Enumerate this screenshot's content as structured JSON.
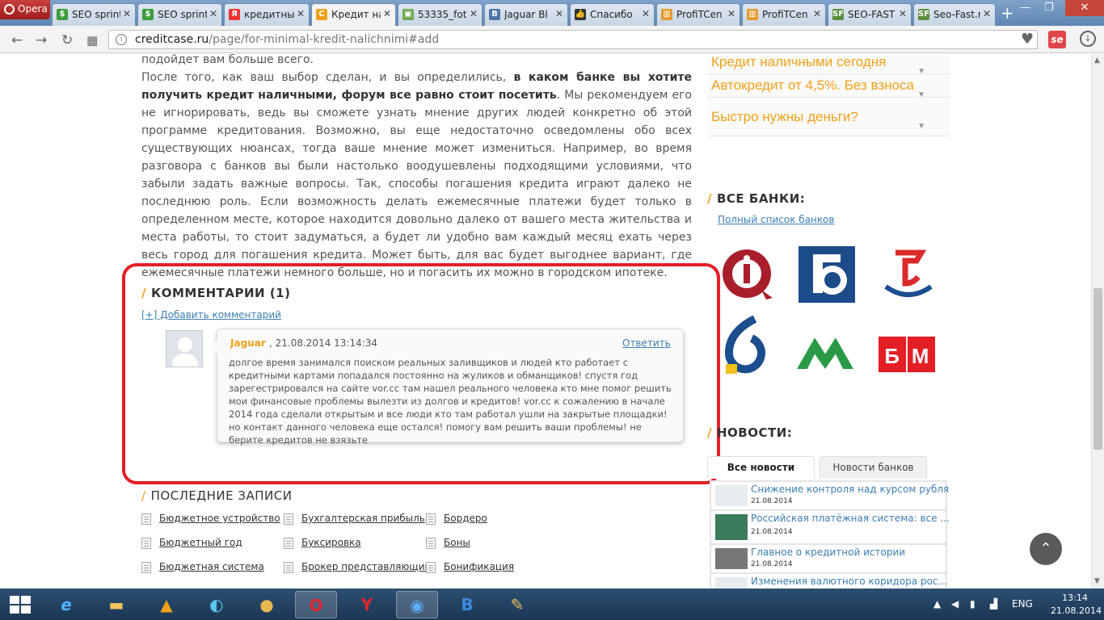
{
  "browser": {
    "menu_label": "Opera",
    "tabs": [
      {
        "label": "SEO sprint",
        "fav_color": "#3a9d3a",
        "fav": "$"
      },
      {
        "label": "SEO sprint",
        "fav_color": "#3a9d3a",
        "fav": "$"
      },
      {
        "label": "кредитны",
        "fav_color": "#e33",
        "fav": "Я"
      },
      {
        "label": "Кредит на",
        "fav_color": "#f0a018",
        "fav": "C"
      },
      {
        "label": "53335_fot",
        "fav_color": "#6aa84f",
        "fav": "▣"
      },
      {
        "label": "Jaguar Bl",
        "fav_color": "#4a76a8",
        "fav": "B"
      },
      {
        "label": "Спасибо",
        "fav_color": "#333",
        "fav": "👍"
      },
      {
        "label": "ProfiTCen",
        "fav_color": "#e39b2c",
        "fav": "▥"
      },
      {
        "label": "ProfiTCen",
        "fav_color": "#e39b2c",
        "fav": "▥"
      },
      {
        "label": "SEO-FAST",
        "fav_color": "#5a8f3a",
        "fav": "SF"
      },
      {
        "label": "Seo-Fast.r",
        "fav_color": "#5a8f3a",
        "fav": "SF"
      }
    ],
    "url_host": "creditcase.ru",
    "url_path": "/page/for-minimal-kredit-nalichnimi#add",
    "se_label": "se"
  },
  "article": {
    "line0": "подойдет вам больше всего.",
    "para_start": "После того, как ваш выбор сделан, и вы определились, ",
    "para_bold": "в каком банке вы хотите получить кредит наличными, форум все равно стоит посетить",
    "para_rest": ". Мы рекомендуем его не игнорировать, ведь вы сможете узнать мнение других людей конкретно об этой программе кредитования. Возможно, вы еще недостаточно осведомлены обо всех существующих нюансах, тогда ваше мнение может измениться. Например, во время разговора с банков вы были настолько воодушевлены подходящими условиями, что забыли задать важные вопросы. Так, способы погашения кредита играют далеко не последнюю роль. Если возможность делать ежемесячные платежи будет только в определенном месте, которое находится довольно далеко от вашего места жительства и места работы, то стоит задуматься, а будет ли удобно вам каждый месяц ехать через весь город для погашения кредита. Может быть, для вас будет выгоднее вариант, где ежемесячные платежи немного больше, но и погасить их можно в городском ипотеке."
  },
  "comments": {
    "title": "КОММЕНТАРИИ (1)",
    "add_link": "[+] Добавить комментарий",
    "author": "Jaguar",
    "date": ", 21.08.2014 13:14:34",
    "reply": "Ответить",
    "text": "долгое время занимался поиском реальных заливщиков и людей кто работает с кредитными картами попадался постоянно на жуликов и обманщиков! спустя год зарегестрировался на сайте vor.cc там нашел реального человека кто мне помог решить мои финансовые проблемы вылезти из долгов и кредитов! vor.cc к сожалению в начале 2014 года сделали открытым и все люди кто там работал ушли на закрытые площадки! но контакт данного человека еще остался! помогу вам решить ваши проблемы! не берите кредитов не взязьте"
  },
  "latest_posts": {
    "title": "ПОСЛЕДНИЕ ЗАПИСИ",
    "items": [
      "Бюджетное устройство",
      "Бухгалтерская прибыль",
      "Бордеро",
      "Бюджетный год",
      "Буксировка",
      "Боны",
      "Бюджетная система",
      "Брокер представляющий",
      "Бонификация"
    ]
  },
  "sidebar": {
    "accordion": [
      "Кредит наличными сегодня",
      "Автокредит от 4,5%. Без взноса",
      "Быстро нужны деньги?"
    ],
    "banks_title": "ВСЕ БАНКИ:",
    "banks_link": "Полный список банков",
    "news_title": "НОВОСТИ:",
    "news_tabs": [
      "Все новости",
      "Новости банков"
    ],
    "news": [
      {
        "title": "Снижение контроля над курсом рубля",
        "date": "21.08.2014"
      },
      {
        "title": "Российская платёжная система: все ...",
        "date": "21.08.2014"
      },
      {
        "title": "Главное о кредитной истории",
        "date": "21.08.2014"
      },
      {
        "title": "Изменения валютного коридора рос...",
        "date": ""
      }
    ]
  },
  "taskbar": {
    "lang": "ENG",
    "time": "13:14",
    "date": "21.08.2014"
  },
  "colors": {
    "accent": "#f0a018",
    "link": "#3c7fb1",
    "highlight": "#e21f27"
  }
}
